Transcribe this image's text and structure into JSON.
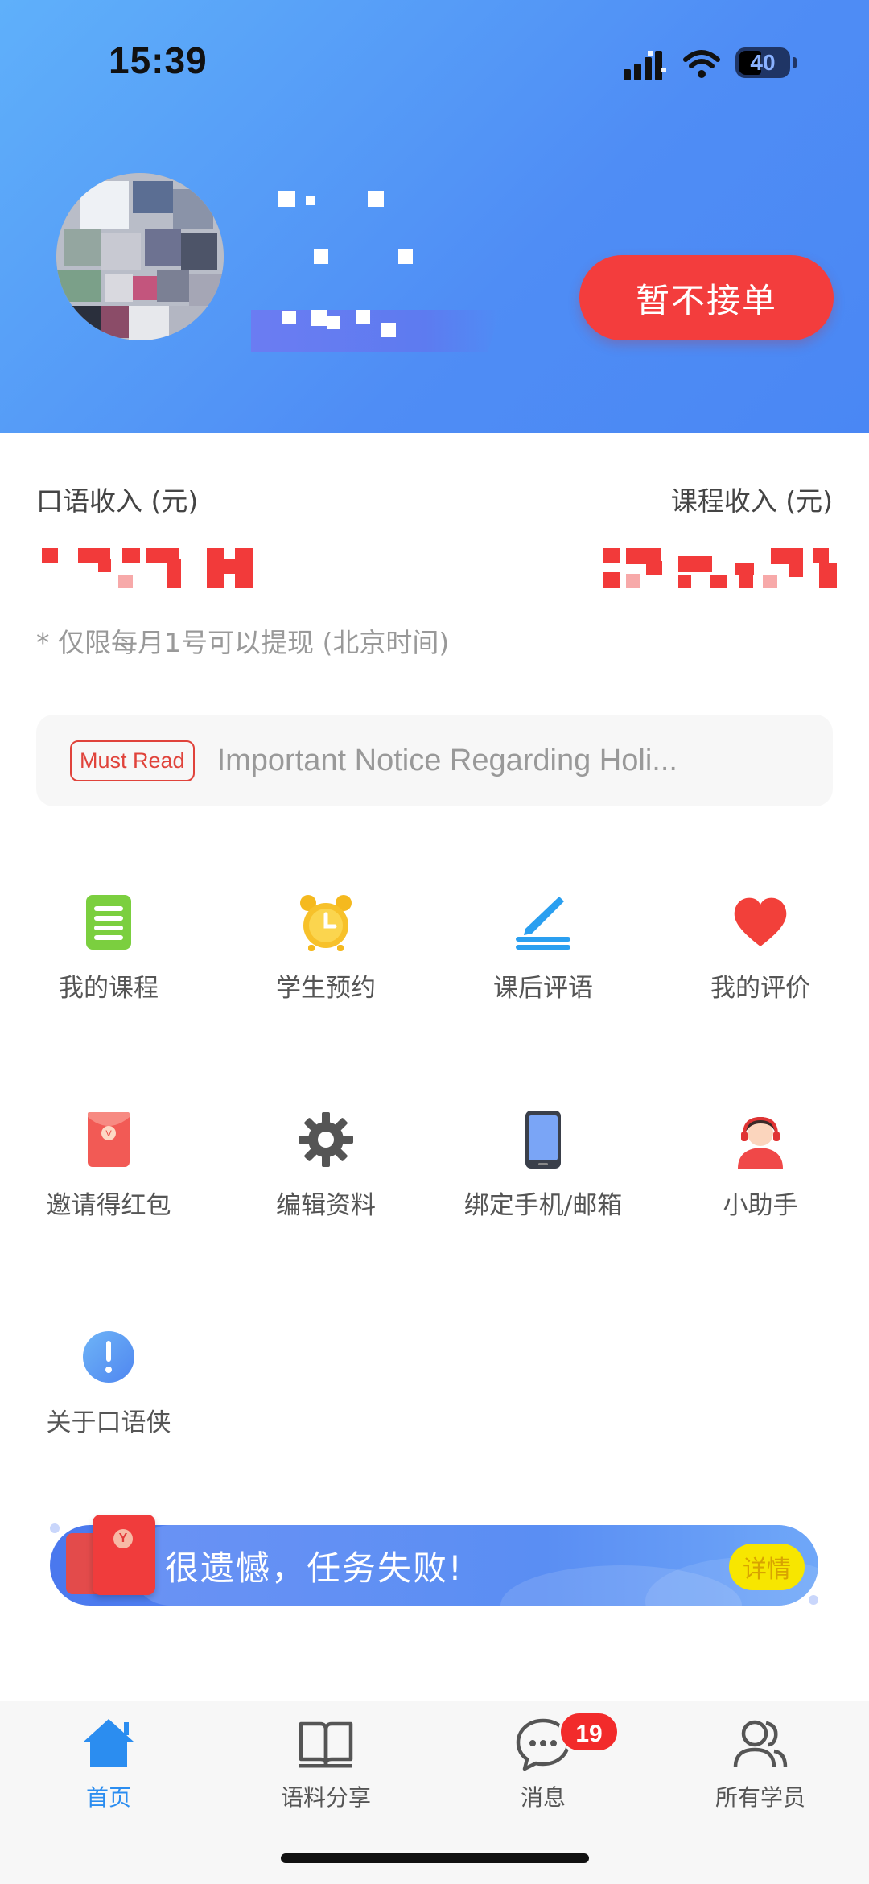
{
  "status_bar": {
    "time": "15:39",
    "battery": "40"
  },
  "header": {
    "status_button": "暂不接单"
  },
  "income": {
    "speaking_label": "口语收入 (元)",
    "course_label": "课程收入 (元)",
    "note": "* 仅限每月1号可以提现 (北京时间)"
  },
  "notice": {
    "tag": "Must Read",
    "text": "Important Notice Regarding Holi..."
  },
  "menu": [
    {
      "label": "我的课程",
      "icon": "course-book-icon"
    },
    {
      "label": "学生预约",
      "icon": "alarm-clock-icon"
    },
    {
      "label": "课后评语",
      "icon": "pen-comment-icon"
    },
    {
      "label": "我的评价",
      "icon": "heart-icon"
    },
    {
      "label": "邀请得红包",
      "icon": "red-envelope-icon"
    },
    {
      "label": "编辑资料",
      "icon": "gear-icon"
    },
    {
      "label": "绑定手机/邮箱",
      "icon": "phone-icon"
    },
    {
      "label": "小助手",
      "icon": "assistant-icon"
    },
    {
      "label": "关于口语侠",
      "icon": "info-icon"
    }
  ],
  "task_banner": {
    "text": "很遗憾，任务失败!",
    "detail": "详情"
  },
  "tabbar": [
    {
      "label": "首页",
      "icon": "home-icon",
      "active": true
    },
    {
      "label": "语料分享",
      "icon": "book-icon",
      "active": false
    },
    {
      "label": "消息",
      "icon": "chat-icon",
      "active": false,
      "badge": "19"
    },
    {
      "label": "所有学员",
      "icon": "users-icon",
      "active": false
    }
  ],
  "colors": {
    "accent": "#2b8df0",
    "danger": "#f33d3d",
    "header_start": "#5fb0fa",
    "header_end": "#4a87f4"
  }
}
